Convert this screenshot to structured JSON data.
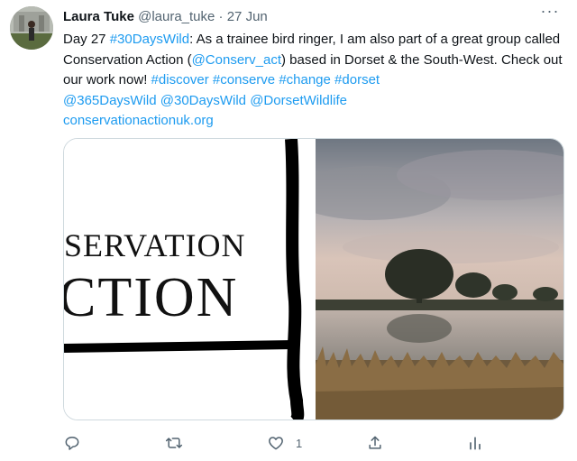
{
  "tweet": {
    "author_name": "Laura Tuke",
    "handle": "@laura_tuke",
    "separator": "·",
    "date": "27 Jun",
    "more_label": "···",
    "text_parts": [
      "Day 27 ",
      "#30DaysWild",
      ": As a trainee bird ringer, I am also part of a great group called Conservation Action (",
      "@Conserv_act",
      ") based in Dorset & the South-West. Check out our work now! ",
      "#discover",
      " ",
      "#conserve",
      " ",
      "#change",
      " ",
      "#dorset",
      " ",
      "@365DaysWild",
      " ",
      "@30DaysWild",
      " ",
      "@DorsetWildlife",
      " ",
      "conservationactionuk.org"
    ],
    "media": {
      "logo_line1": "SERVATION",
      "logo_line2": "CTION"
    },
    "actions": {
      "reply_count": "",
      "retweet_count": "",
      "like_count": "1"
    }
  },
  "colors": {
    "link": "#1d9bf0",
    "secondary_text": "#536471",
    "primary_text": "#0f1419"
  },
  "icons": [
    "avatar",
    "more-icon",
    "reply-icon",
    "retweet-icon",
    "like-icon",
    "share-icon",
    "analytics-icon"
  ]
}
